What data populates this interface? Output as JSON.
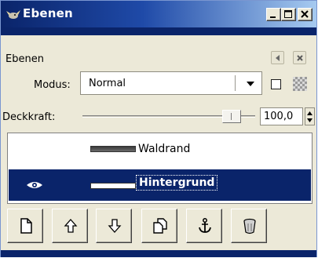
{
  "window": {
    "title": "Ebenen"
  },
  "titlebar": {
    "icon": "gimp-wilber-icon",
    "buttons": [
      "minimize-icon",
      "maximize-icon",
      "close-icon"
    ]
  },
  "panel": {
    "label": "Ebenen",
    "header_buttons": [
      "menu-arrow-icon",
      "close-icon"
    ]
  },
  "mode": {
    "label": "Modus:",
    "value": "Normal"
  },
  "opacity": {
    "label": "Deckkraft:",
    "value": "100,0",
    "slider_percent": 100
  },
  "layers": [
    {
      "name": "Waldrand",
      "visible": false,
      "selected": false
    },
    {
      "name": "Hintergrund",
      "visible": true,
      "selected": true
    }
  ],
  "toolbar": {
    "buttons": [
      "new-layer-icon",
      "raise-layer-icon",
      "lower-layer-icon",
      "duplicate-layer-icon",
      "anchor-layer-icon",
      "delete-layer-icon"
    ]
  },
  "colors": {
    "titlebar": "#0a246a",
    "selection": "#0a246a",
    "face": "#ece9d8"
  }
}
